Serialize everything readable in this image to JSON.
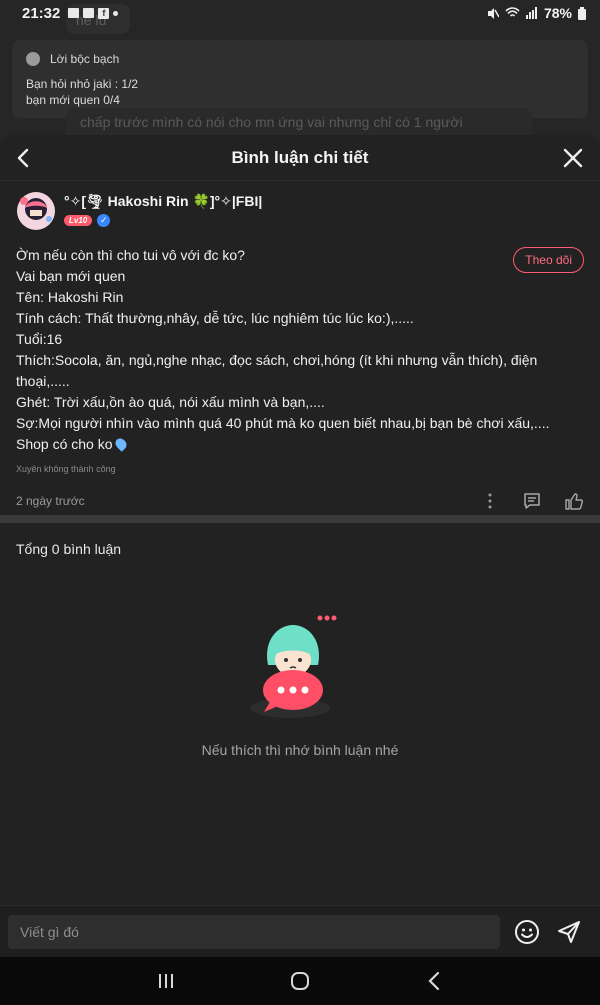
{
  "status_bar": {
    "time": "21:32",
    "battery": "78%"
  },
  "background_chat": {
    "ghost_top_text": "hế lu",
    "card_title": "Lời bộc bạch",
    "card_lines": [
      "Bạn hỏi nhỏ jaki : 1/2",
      "bạn mới quen 0/4"
    ],
    "ghost_message": "chấp trước mình có nói cho mn ứng vai nhưng chỉ có 1 người"
  },
  "sheet": {
    "title": "Bình luận chi tiết",
    "author": {
      "name": "°✧[🌪 Hakoshi Rin 🍀]°✧|FBI|",
      "level": "Lv10"
    },
    "follow_label": "Theo dõi",
    "content_lines": [
      "Ờm nếu còn thì cho tui vô với đc ko?",
      "Vai bạn mới quen",
      "Tên: Hakoshi Rin",
      "Tính cách: Thất thường,nhây, dễ tức, lúc nghiêm túc lúc ko:),.....",
      "Tuổi:16",
      "Thích:Socola, ăn, ngủ,nghe nhạc, đọc sách, chơi,hóng (ít khi nhưng vẫn thích), điện thoại,.....",
      "Ghét: Trời xấu,ồn ào quá, nói xấu mình và bạn,....",
      "Sợ:Mọi người nhìn vào mình quá 40 phút mà ko quen biết nhau,bị bạn bè chơi xấu,....",
      "Shop có cho ko"
    ],
    "tag": "Xuyên không thành công",
    "time_ago": "2 ngày trước",
    "total_comments": "Tổng 0 bình luận",
    "empty_message": "Nếu thích thì nhớ bình luận nhé"
  },
  "composer": {
    "placeholder": "Viết gì đó"
  },
  "icons": {
    "back": "back-arrow-icon",
    "close": "close-icon",
    "more": "more-vertical-icon",
    "reply": "comment-icon",
    "like": "thumbs-up-icon",
    "emoji": "emoji-icon",
    "send": "send-icon"
  },
  "colors": {
    "accent": "#ff5b72",
    "sheet_bg": "#222222",
    "page_bg": "#1b1b1b"
  }
}
